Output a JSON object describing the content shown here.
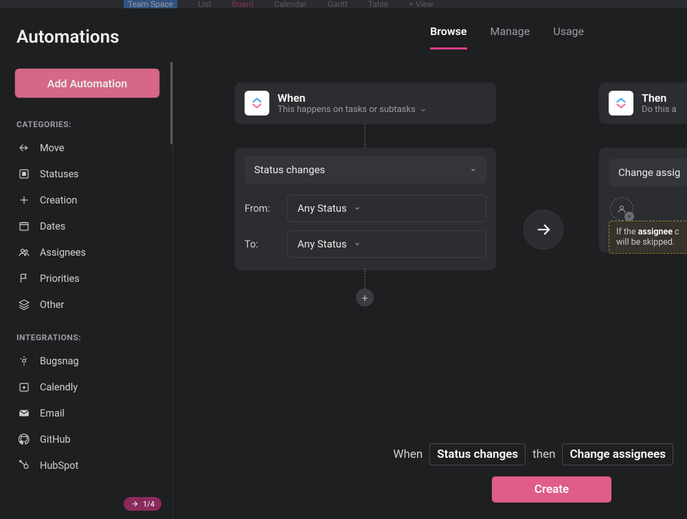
{
  "topstrip": {
    "space": "Team Space",
    "views": [
      "List",
      "Board",
      "Calendar",
      "Gantt",
      "Table",
      "+ View"
    ]
  },
  "header": {
    "title": "Automations",
    "tabs": [
      {
        "label": "Browse",
        "active": true
      },
      {
        "label": "Manage",
        "active": false
      },
      {
        "label": "Usage",
        "active": false
      }
    ]
  },
  "sidebar": {
    "add_button": "Add Automation",
    "categories_label": "CATEGORIES:",
    "categories": [
      {
        "icon": "move",
        "label": "Move"
      },
      {
        "icon": "status",
        "label": "Statuses"
      },
      {
        "icon": "creation",
        "label": "Creation"
      },
      {
        "icon": "dates",
        "label": "Dates"
      },
      {
        "icon": "assignees",
        "label": "Assignees"
      },
      {
        "icon": "priorities",
        "label": "Priorities"
      },
      {
        "icon": "other",
        "label": "Other"
      }
    ],
    "integrations_label": "INTEGRATIONS:",
    "integrations": [
      {
        "icon": "bugsnag",
        "label": "Bugsnag"
      },
      {
        "icon": "calendly",
        "label": "Calendly"
      },
      {
        "icon": "email",
        "label": "Email"
      },
      {
        "icon": "github",
        "label": "GitHub"
      },
      {
        "icon": "hubspot",
        "label": "HubSpot"
      }
    ]
  },
  "builder": {
    "when": {
      "title": "When",
      "subtitle": "This happens on tasks or subtasks"
    },
    "trigger": {
      "type_label": "Status changes",
      "from_label": "From:",
      "from_value": "Any Status",
      "to_label": "To:",
      "to_value": "Any Status"
    },
    "then": {
      "title": "Then",
      "subtitle": "Do this a"
    },
    "action": {
      "type_label": "Change assig",
      "warning_prefix": "If the ",
      "warning_bold": "assignee",
      "warning_suffix_line1": " c",
      "warning_line2": "will be skipped."
    }
  },
  "footer": {
    "when_word": "When",
    "when_pill": "Status changes",
    "then_word": "then",
    "then_pill": "Change assignees",
    "create_label": "Create"
  },
  "bottom_badge": "1/4"
}
